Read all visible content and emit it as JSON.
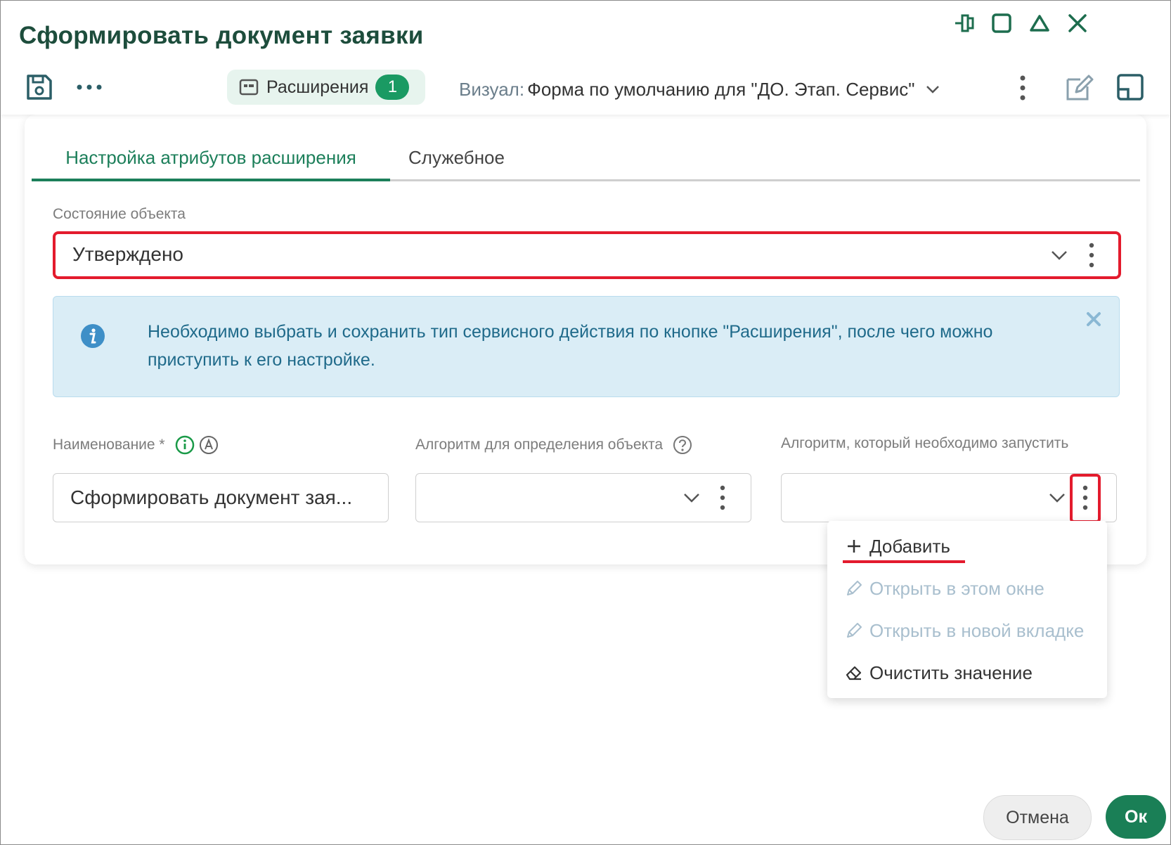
{
  "window": {
    "title": "Сформировать документ заявки"
  },
  "toolbar": {
    "extensions_label": "Расширения",
    "extensions_count": "1",
    "visual_label": "Визуал:",
    "visual_value": "Форма по умолчанию для \"ДО. Этап. Сервис\""
  },
  "tabs": [
    {
      "label": "Настройка атрибутов расширения",
      "active": true
    },
    {
      "label": "Служебное",
      "active": false
    }
  ],
  "form": {
    "state": {
      "label": "Состояние объекта",
      "value": "Утверждено"
    },
    "info_message": "Необходимо выбрать и сохранить тип сервисного действия по кнопке \"Расширения\", после чего можно приступить к его настройке.",
    "name": {
      "label": "Наименование *",
      "value": "Сформировать документ зая..."
    },
    "algorithm_object": {
      "label": "Алгоритм для определения объекта",
      "value": ""
    },
    "algorithm_run": {
      "label": "Алгоритм, который необходимо запустить",
      "value": ""
    }
  },
  "context_menu": {
    "items": [
      {
        "label": "Добавить",
        "icon": "plus-icon",
        "enabled": true
      },
      {
        "label": "Открыть в этом окне",
        "icon": "pencil-icon",
        "enabled": false
      },
      {
        "label": "Открыть в новой вкладке",
        "icon": "pencil-icon",
        "enabled": false
      },
      {
        "label": "Очистить значение",
        "icon": "eraser-icon",
        "enabled": true
      }
    ]
  },
  "footer": {
    "cancel_label": "Отмена",
    "ok_label": "Ок"
  },
  "colors": {
    "accent": "#1a7f56",
    "title": "#1d4d3c",
    "highlight": "#e31b2d",
    "info_bg": "#daedf6",
    "info_text": "#1f6a8a",
    "disabled_text": "#a9bfce"
  }
}
